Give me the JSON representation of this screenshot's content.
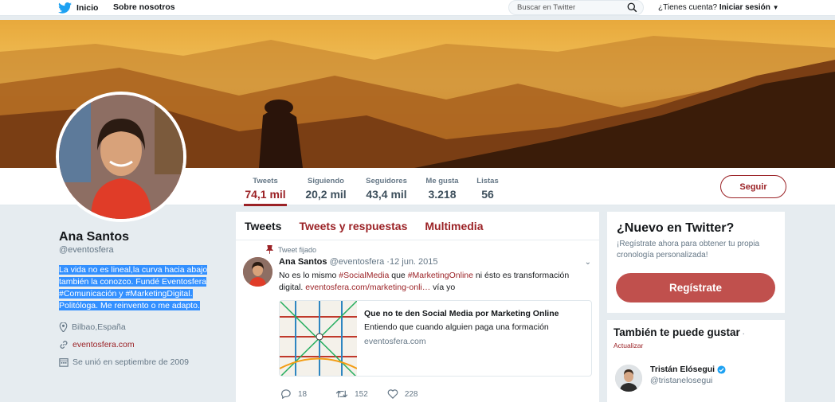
{
  "topnav": {
    "home_label": "Inicio",
    "about_label": "Sobre nosotros",
    "search_placeholder": "Buscar en Twitter",
    "login_prompt": "¿Tienes cuenta?",
    "login_label": "Iniciar sesión"
  },
  "stats": [
    {
      "label": "Tweets",
      "value": "74,1 mil"
    },
    {
      "label": "Siguiendo",
      "value": "20,2 mil"
    },
    {
      "label": "Seguidores",
      "value": "43,4 mil"
    },
    {
      "label": "Me gusta",
      "value": "3.218"
    },
    {
      "label": "Listas",
      "value": "56"
    }
  ],
  "follow_label": "Seguir",
  "profile": {
    "name": "Ana Santos",
    "handle": "@eventosfera",
    "bio": "La vida no es lineal,la curva hacia abajo también la conozco. Fundé Eventosfera #Comunicación y #MarketingDigital. Politóloga. Me reinvento o me adapto.",
    "location": "Bilbao,España",
    "website": "eventosfera.com",
    "joined": "Se unió en septiembre de 2009"
  },
  "timeline": {
    "tabs": [
      "Tweets",
      "Tweets y respuestas",
      "Multimedia"
    ],
    "pinned_label": "Tweet fijado",
    "tweet": {
      "author": "Ana Santos",
      "handle": "@eventosfera",
      "date": "·12 jun. 2015",
      "text_1": "No es lo mismo ",
      "hashtag_1": "#SocialMedia",
      "text_2": " que ",
      "hashtag_2": "#MarketingOnline",
      "text_3": " ni ésto es transformación digital. ",
      "link": "eventosfera.com/marketing-onli…",
      "text_4": " vía yo",
      "card_title": "Que no te den Social Media por Marketing Online",
      "card_desc": "Entiendo que cuando alguien paga una formación",
      "card_domain": "eventosfera.com",
      "replies": "18",
      "retweets": "152",
      "likes": "228"
    }
  },
  "signup": {
    "title": "¿Nuevo en Twitter?",
    "text": "¡Regístrate ahora para obtener tu propia cronología personalizada!",
    "button": "Regístrate"
  },
  "who_to_follow": {
    "title": "También te puede gustar",
    "sep": " ·",
    "update": "Actualizar",
    "user_name": "Tristán Elósegui",
    "user_handle": "@tristanelosegui"
  },
  "colors": {
    "accent": "#9b2226",
    "twitter_blue": "#1da1f2",
    "signup_button": "#c0504d"
  }
}
